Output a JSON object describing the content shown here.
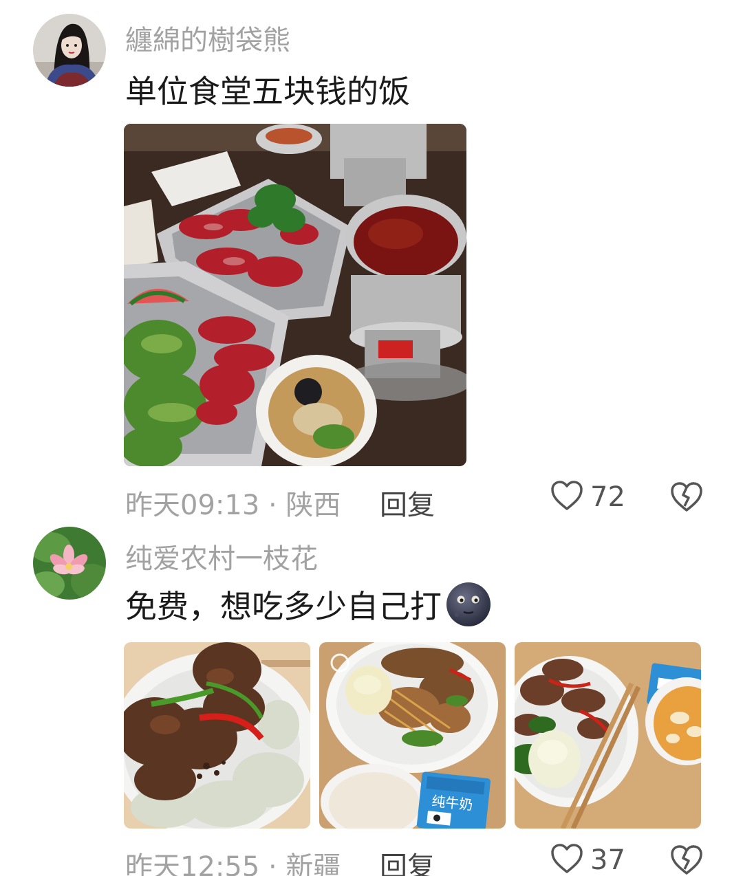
{
  "comments": [
    {
      "username": "纏綿的樹袋熊",
      "text": "单位食堂五块钱的饭",
      "time_location": "昨天09:13 · 陕西",
      "reply_label": "回复",
      "like_count": "72",
      "images": [
        "hotpot-table-photo"
      ]
    },
    {
      "username": "纯爱农村一枝花",
      "text": "免费，想吃多少自己打",
      "emoji": "moon-face",
      "time_location": "昨天12:55 · 新疆",
      "reply_label": "回复",
      "like_count": "37",
      "images": [
        "beef-dumplings-photo",
        "noodles-plate-photo",
        "stirfry-bun-photo"
      ],
      "milk_label": "纯牛奶"
    }
  ],
  "colors": {
    "meta_text": "#a2a2a2",
    "body_text": "#1a1a1a",
    "icon": "#555555"
  }
}
